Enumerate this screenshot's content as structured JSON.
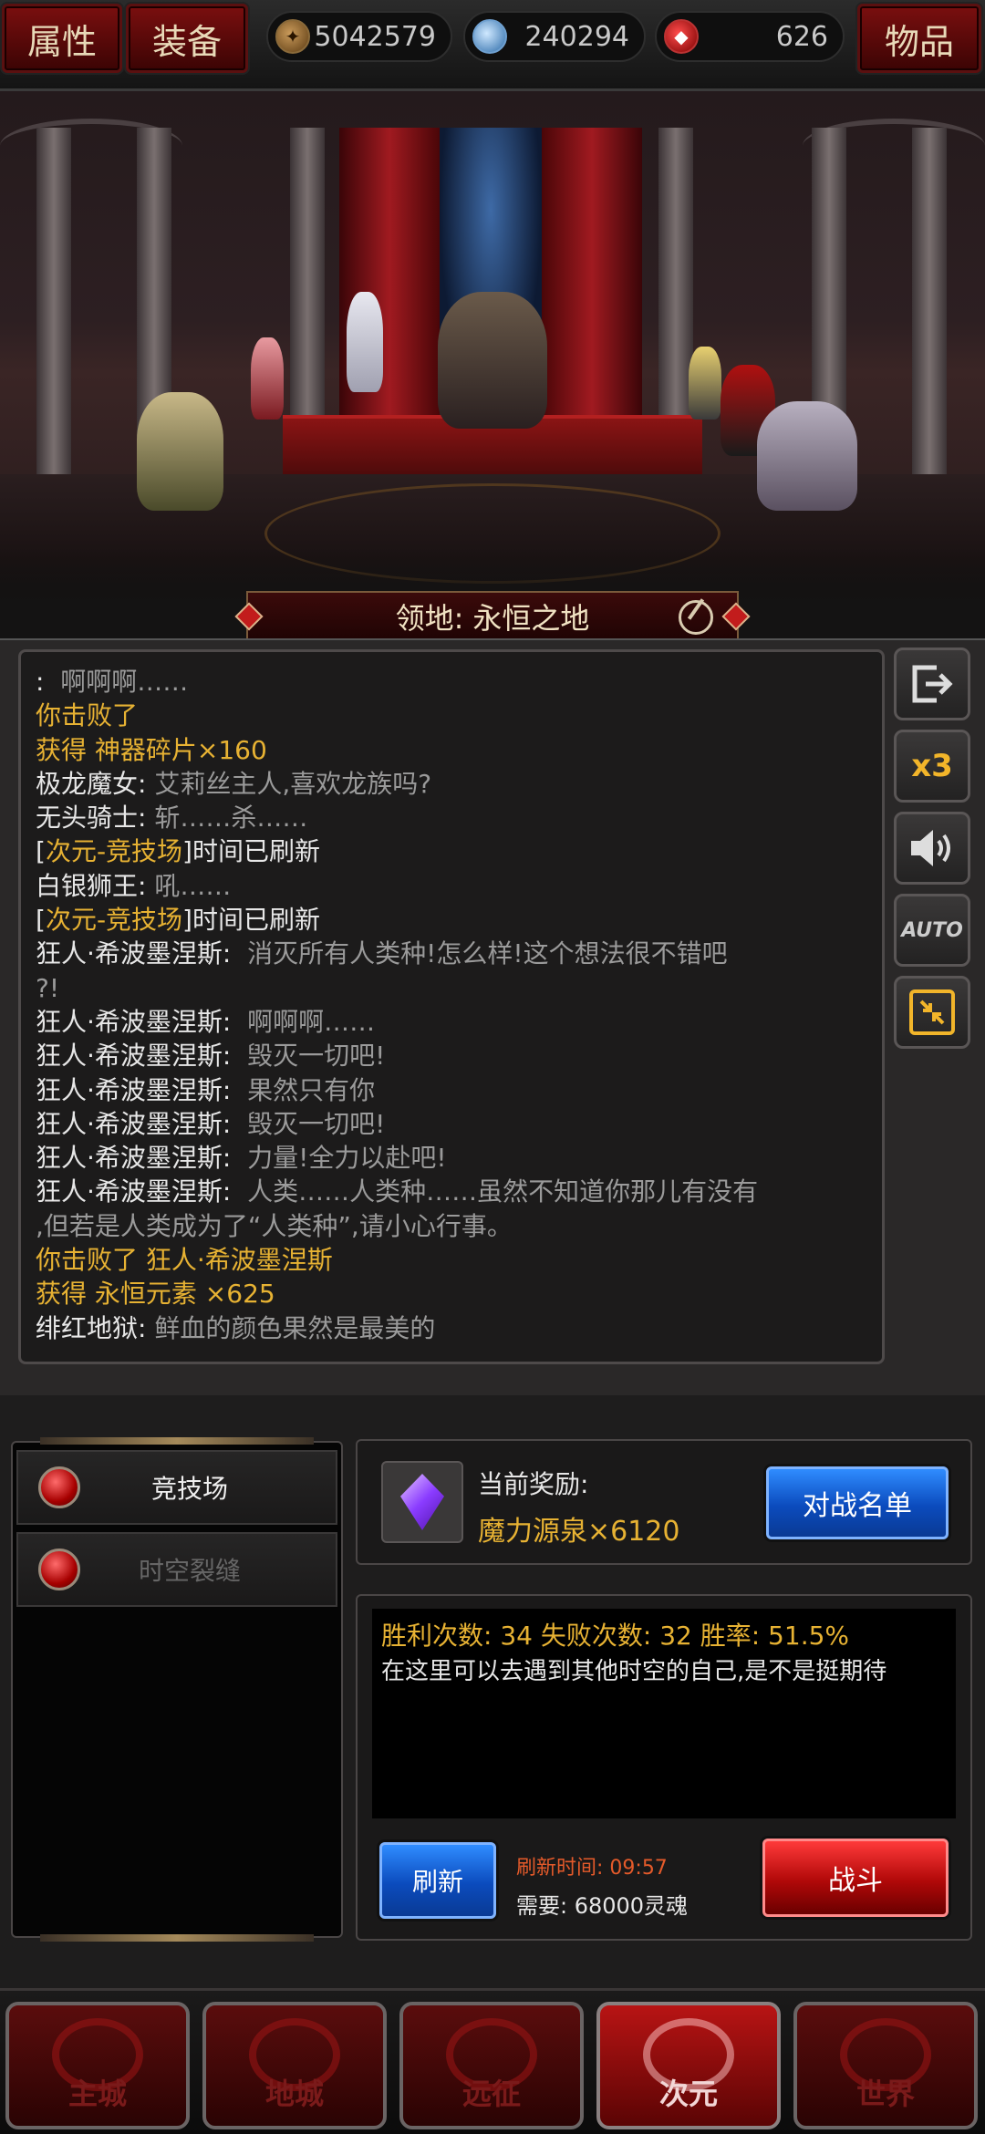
{
  "topbar": {
    "attr_label": "属性",
    "equip_label": "装备",
    "items_label": "物品",
    "gold": "5042579",
    "gems": "240294",
    "souls": "626"
  },
  "territory": {
    "label": "领地:",
    "name": "永恒之地"
  },
  "log": [
    {
      "parts": [
        {
          "t": ":  ",
          "c": "w"
        },
        {
          "t": "啊啊啊……",
          "c": "g"
        }
      ]
    },
    {
      "parts": [
        {
          "t": "你击败了",
          "c": "y"
        }
      ]
    },
    {
      "parts": [
        {
          "t": "获得 神器碎片×160",
          "c": "y"
        }
      ]
    },
    {
      "parts": [
        {
          "t": "极龙魔女: ",
          "c": "w"
        },
        {
          "t": "艾莉丝主人,喜欢龙族吗?",
          "c": "g"
        }
      ]
    },
    {
      "parts": [
        {
          "t": "无头骑士: ",
          "c": "w"
        },
        {
          "t": "斩……杀……",
          "c": "g"
        }
      ]
    },
    {
      "parts": [
        {
          "t": "[",
          "c": "w"
        },
        {
          "t": "次元-竞技场",
          "c": "y"
        },
        {
          "t": "]时间已刷新",
          "c": "w"
        }
      ]
    },
    {
      "parts": [
        {
          "t": "白银狮王: ",
          "c": "w"
        },
        {
          "t": "吼……",
          "c": "g"
        }
      ]
    },
    {
      "parts": [
        {
          "t": "[",
          "c": "w"
        },
        {
          "t": "次元-竞技场",
          "c": "y"
        },
        {
          "t": "]时间已刷新",
          "c": "w"
        }
      ]
    },
    {
      "parts": [
        {
          "t": "狂人·希波墨涅斯:  ",
          "c": "w"
        },
        {
          "t": "消灭所有人类种!怎么样!这个想法很不错吧",
          "c": "g"
        }
      ]
    },
    {
      "parts": [
        {
          "t": "?!",
          "c": "g"
        }
      ]
    },
    {
      "parts": [
        {
          "t": "狂人·希波墨涅斯:  ",
          "c": "w"
        },
        {
          "t": "啊啊啊……",
          "c": "g"
        }
      ]
    },
    {
      "parts": [
        {
          "t": "狂人·希波墨涅斯:  ",
          "c": "w"
        },
        {
          "t": "毁灭一切吧!",
          "c": "g"
        }
      ]
    },
    {
      "parts": [
        {
          "t": "狂人·希波墨涅斯:  ",
          "c": "w"
        },
        {
          "t": "果然只有你",
          "c": "g"
        }
      ]
    },
    {
      "parts": [
        {
          "t": "狂人·希波墨涅斯:  ",
          "c": "w"
        },
        {
          "t": "毁灭一切吧!",
          "c": "g"
        }
      ]
    },
    {
      "parts": [
        {
          "t": "狂人·希波墨涅斯:  ",
          "c": "w"
        },
        {
          "t": "力量!全力以赴吧!",
          "c": "g"
        }
      ]
    },
    {
      "parts": [
        {
          "t": "狂人·希波墨涅斯:  ",
          "c": "w"
        },
        {
          "t": "人类……人类种……虽然不知道你那儿有没有",
          "c": "g"
        }
      ]
    },
    {
      "parts": [
        {
          "t": ",但若是人类成为了“人类种”,请小心行事。",
          "c": "g"
        }
      ]
    },
    {
      "parts": [
        {
          "t": "你击败了 狂人·希波墨涅斯",
          "c": "y"
        }
      ]
    },
    {
      "parts": [
        {
          "t": "获得 永恒元素 ×625",
          "c": "y"
        }
      ]
    },
    {
      "parts": [
        {
          "t": "绯红地狱: ",
          "c": "w"
        },
        {
          "t": "鲜血的颜色果然是最美的",
          "c": "g"
        }
      ]
    }
  ],
  "side": {
    "speed_label": "x3",
    "auto_label": "AUTO"
  },
  "menu": {
    "arena_label": "竞技场",
    "rift_label": "时空裂缝"
  },
  "reward": {
    "label": "当前奖励:",
    "value": "魔力源泉×6120",
    "roster_button": "对战名单"
  },
  "stats": {
    "line": "胜利次数: 34  失败次数: 32  胜率: 51.5%",
    "desc": "在这里可以去遇到其他时空的自己,是不是挺期待",
    "refresh_button": "刷新",
    "refresh_time_label": "刷新时间: ",
    "refresh_time": "09:57",
    "cost": "需要: 68000灵魂",
    "fight_button": "战斗"
  },
  "nav": {
    "main": "主城",
    "dungeon": "地城",
    "expedition": "远征",
    "dimension": "次元",
    "world": "世界"
  }
}
